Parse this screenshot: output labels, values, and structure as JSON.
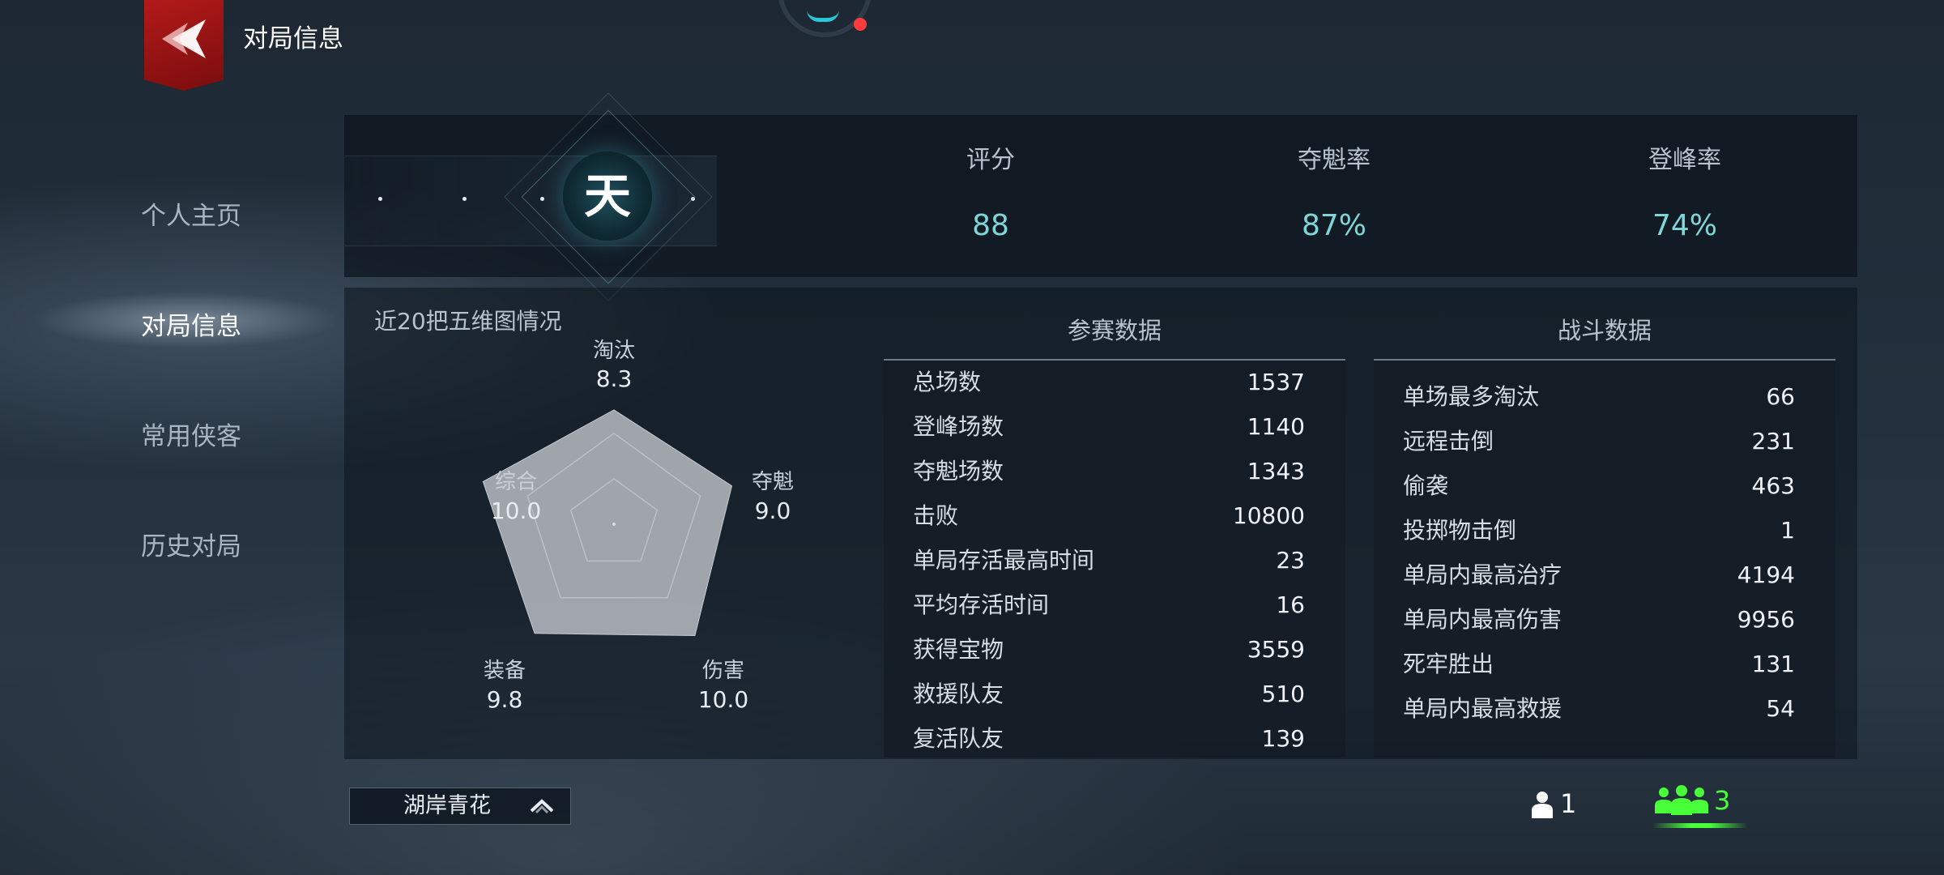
{
  "header": {
    "title": "对局信息",
    "logo_icon": "red-crest-icon",
    "dial_icon": "network-dial-icon"
  },
  "sidebar": {
    "items": [
      {
        "label": "个人主页",
        "active": false
      },
      {
        "label": "对局信息",
        "active": true
      },
      {
        "label": "常用侠客",
        "active": false
      },
      {
        "label": "历史对局",
        "active": false
      }
    ]
  },
  "rank": {
    "character": "天"
  },
  "summary": {
    "score_label": "评分",
    "score_value": "88",
    "win_rate_label": "夺魁率",
    "win_rate_value": "87%",
    "peak_rate_label": "登峰率",
    "peak_rate_value": "74%"
  },
  "radar": {
    "title": "近20把五维图情况",
    "max": 10,
    "axes": [
      {
        "label": "淘汰",
        "value": 8.3,
        "display": "8.3"
      },
      {
        "label": "夺魁",
        "value": 9.0,
        "display": "9.0"
      },
      {
        "label": "伤害",
        "value": 10.0,
        "display": "10.0"
      },
      {
        "label": "装备",
        "value": 9.8,
        "display": "9.8"
      },
      {
        "label": "综合",
        "value": 10.0,
        "display": "10.0"
      }
    ]
  },
  "match_stats": {
    "title": "参赛数据",
    "rows": [
      {
        "key": "总场数",
        "value": "1537"
      },
      {
        "key": "登峰场数",
        "value": "1140"
      },
      {
        "key": "夺魁场数",
        "value": "1343"
      },
      {
        "key": "击败",
        "value": "10800"
      },
      {
        "key": "单局存活最高时间",
        "value": "23"
      },
      {
        "key": "平均存活时间",
        "value": "16"
      },
      {
        "key": "获得宝物",
        "value": "3559"
      },
      {
        "key": "救援队友",
        "value": "510"
      },
      {
        "key": "复活队友",
        "value": "139"
      }
    ]
  },
  "combat_stats": {
    "title": "战斗数据",
    "rows": [
      {
        "key": "单场最多淘汰",
        "value": "66"
      },
      {
        "key": "远程击倒",
        "value": "231"
      },
      {
        "key": "偷袭",
        "value": "463"
      },
      {
        "key": "投掷物击倒",
        "value": "1"
      },
      {
        "key": "单局内最高治疗",
        "value": "4194"
      },
      {
        "key": "单局内最高伤害",
        "value": "9956"
      },
      {
        "key": "死牢胜出",
        "value": "131"
      },
      {
        "key": "单局内最高救援",
        "value": "54"
      }
    ]
  },
  "footer": {
    "season_label": "湖岸青花",
    "solo_count": "1",
    "squad_count": "3",
    "squad_color": "#49ff3a",
    "radar_fill_color": "#a8adb3",
    "value_color": "#7fd6d8"
  }
}
